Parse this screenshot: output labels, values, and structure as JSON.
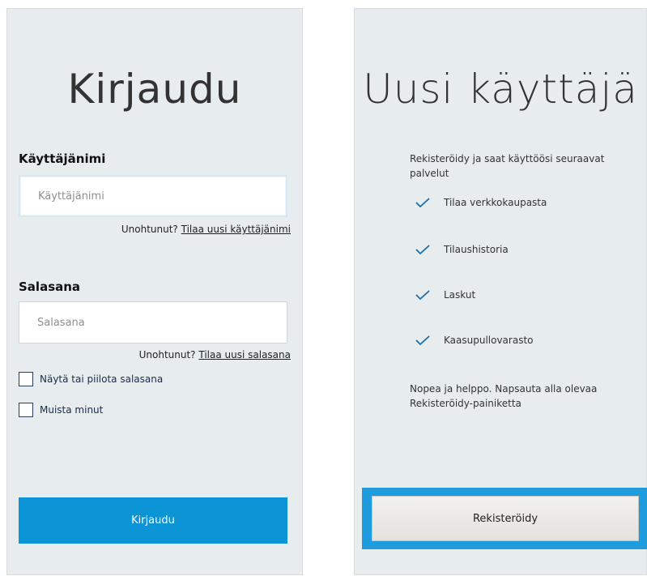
{
  "login": {
    "title": "Kirjaudu",
    "username_label": "Käyttäjänimi",
    "username_placeholder": "Käyttäjänimi",
    "username_forgot_prefix": "Unohtunut?",
    "username_forgot_link": "Tilaa uusi käyttäjänimi",
    "password_label": "Salasana",
    "password_placeholder": "Salasana",
    "password_forgot_prefix": "Unohtunut?",
    "password_forgot_link": "Tilaa uusi salasana",
    "show_password_label": "Näytä tai piilota salasana",
    "remember_me_label": "Muista minut",
    "submit_label": "Kirjaudu"
  },
  "register": {
    "title": "Uusi käyttäjä",
    "intro": "Rekisteröidy ja saat käyttöösi seuraavat palvelut",
    "features": [
      "Tilaa verkkokaupasta",
      "Tilaushistoria",
      "Laskut",
      "Kaasupullovarasto"
    ],
    "outro": "Nopea ja helppo. Napsauta alla olevaa Rekisteröidy-painiketta",
    "button_label": "Rekisteröidy"
  },
  "icons": {
    "feature_check": "check-icon"
  },
  "colors": {
    "panel_bg": "#e7ecef",
    "primary_button": "#0b94d6",
    "highlight_frame": "#1d9bdc",
    "check_color": "#1a6fa8"
  }
}
